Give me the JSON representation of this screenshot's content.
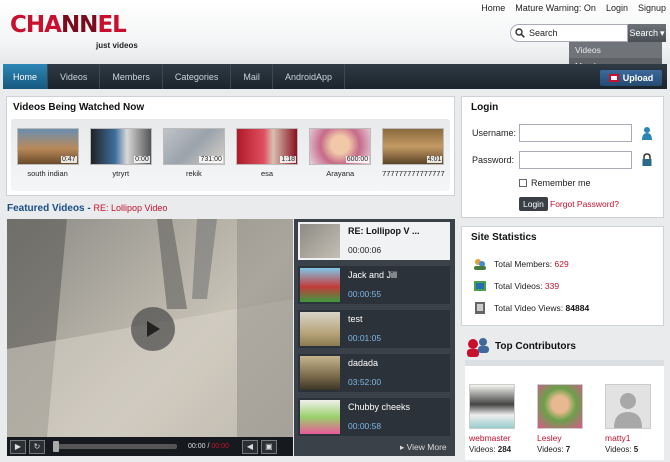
{
  "header": {
    "logo_text": "CHANNEL",
    "tagline": "just videos",
    "toplinks": [
      "Home",
      "Mature Warning: On",
      "Login",
      "Signup"
    ],
    "search_value": "Search",
    "search_button": "Search",
    "search_options": [
      "Videos",
      "Members"
    ]
  },
  "nav": {
    "items": [
      "Home",
      "Videos",
      "Members",
      "Categories",
      "Mail",
      "AndroidApp"
    ],
    "upload": "Upload"
  },
  "watched": {
    "title": "Videos Being Watched Now",
    "videos": [
      {
        "title": "south indian",
        "duration": "0:47"
      },
      {
        "title": "ytryrt",
        "duration": "0:00"
      },
      {
        "title": "rekik",
        "duration": "731:00"
      },
      {
        "title": "esa",
        "duration": "1:18"
      },
      {
        "title": "Arayana",
        "duration": "600:00"
      },
      {
        "title": "777777777777777",
        "duration": "4:01"
      }
    ]
  },
  "featured": {
    "label": "Featured Videos -",
    "subtitle": "RE: Lollipop Video",
    "time_current": "00:00",
    "time_total": "00:00",
    "view_more": "View More",
    "playlist": [
      {
        "title": "RE: Lollipop V ...",
        "time": "00:00:06"
      },
      {
        "title": "Jack and Jill",
        "time": "00:00:55"
      },
      {
        "title": "test",
        "time": "00:01:05"
      },
      {
        "title": "dadada",
        "time": "03:52:00"
      },
      {
        "title": "Chubby cheeks",
        "time": "00:00:58"
      }
    ]
  },
  "login": {
    "title": "Login",
    "username_label": "Username:",
    "password_label": "Password:",
    "remember": "Remember me",
    "button": "Login",
    "forgot": "Forgot Password?"
  },
  "stats": {
    "title": "Site Statistics",
    "members_label": "Total Members:",
    "members_value": "629",
    "videos_label": "Total Videos:",
    "videos_value": "339",
    "views_label": "Total Video Views:",
    "views_value": "84884"
  },
  "contributors": {
    "title": "Top Contributors",
    "videos_label": "Videos:",
    "list": [
      {
        "name": "webmaster",
        "videos": "284"
      },
      {
        "name": "Lesley",
        "videos": "7"
      },
      {
        "name": "matty1",
        "videos": "5"
      }
    ]
  },
  "colors": {
    "brand_red": "#c8102e",
    "nav_dark": "#1b242c",
    "nav_active": "#2c86b5"
  }
}
